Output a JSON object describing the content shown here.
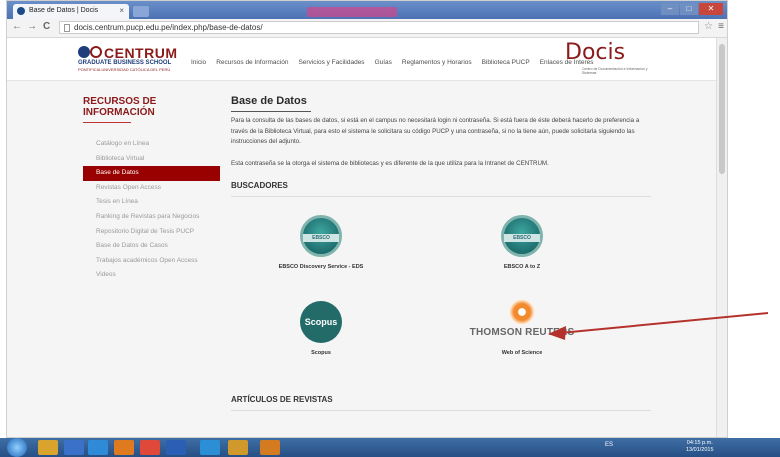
{
  "browser": {
    "tab_title": "Base de Datos | Docis",
    "tab_close": "×",
    "url": "docis.centrum.pucp.edu.pe/index.php/base-de-datos/",
    "nav_back": "←",
    "nav_forward": "→",
    "nav_reload": "C",
    "bookmark_star": "☆",
    "menu_glyph": "≡",
    "win_minimize": "–",
    "win_maximize": "□",
    "win_close": "✕"
  },
  "header": {
    "logo_word": "CENTRUM",
    "logo_sub1": "GRADUATE BUSINESS SCHOOL",
    "logo_sub2": "PONTIFICIA UNIVERSIDAD CATÓLICA DEL PERÚ",
    "nav": [
      "Inicio",
      "Recursos de Información",
      "Servicios y Facilidades",
      "Guías",
      "Reglamentos y Horarios",
      "Biblioteca PUCP",
      "Enlaces de Interes"
    ],
    "docis_word": "Docis",
    "docis_sub": "Centro de Documentación e Información y Sistemas"
  },
  "sidebar": {
    "title": "RECURSOS DE INFORMACIÓN",
    "items": [
      {
        "label": "Catálogo en Línea",
        "active": false
      },
      {
        "label": "Biblioteca Virtual",
        "active": false
      },
      {
        "label": "Base de Datos",
        "active": true
      },
      {
        "label": "Revistas Open Access",
        "active": false
      },
      {
        "label": "Tesis en Línea",
        "active": false
      },
      {
        "label": "Ranking de Revistas para Negocios",
        "active": false
      },
      {
        "label": "Repositorio Digital de Tesis PUCP",
        "active": false
      },
      {
        "label": "Base de Datos de Casos",
        "active": false
      },
      {
        "label": "Trabajos académicos Open Access",
        "active": false
      },
      {
        "label": "Videos",
        "active": false
      }
    ]
  },
  "main": {
    "title": "Base de Datos",
    "paragraph1": "Para la consulta de las bases de datos, si está en el campus no necesitará login ni contraseña. Si está fuera de éste deberá hacerlo de preferencia a través de la Biblioteca Virtual, para esto el sistema le solicitara su código PUCP y una contraseña, si no la tiene aún, puede solicitarla siguiendo las instrucciones del adjunto.",
    "paragraph2": "Esta contraseña se la otorga el sistema de bibliotecas y es diferente de la que utiliza para la Intranet de CENTRUM.",
    "buscadores_heading": "BUSCADORES",
    "databases": [
      {
        "logo_text": "EBSCO",
        "label": "EBSCO Discovery Service - EDS"
      },
      {
        "logo_text": "EBSCO",
        "label": "EBSCO A to Z"
      },
      {
        "logo_text": "Scopus",
        "label": "Scopus"
      },
      {
        "logo_text": "THOMSON REUTERS",
        "label": "Web of Science"
      }
    ],
    "articulos_heading": "ARTÍCULOS DE REVISTAS"
  },
  "taskbar": {
    "tray_text": "ES",
    "time": "04:15 p.m.",
    "date": "13/01/2015"
  },
  "colors": {
    "brand_red": "#990000",
    "ebsco_teal": "#1c6b6b",
    "arrow_red": "#b5322c"
  }
}
